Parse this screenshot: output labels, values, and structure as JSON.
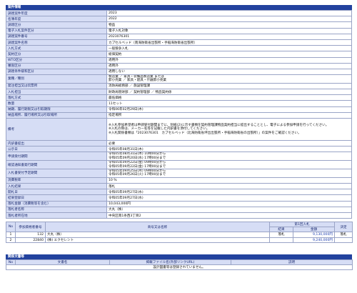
{
  "info_section": {
    "title": "案件情報",
    "rows": [
      {
        "k": "調達案件年度",
        "v": [
          "2023"
        ]
      },
      {
        "k": "名簿年度",
        "v": [
          "2022"
        ]
      },
      {
        "k": "調達区分",
        "v": [
          "物品"
        ]
      },
      {
        "k": "電子入札案件区分",
        "v": [
          "電子入札対象"
        ]
      },
      {
        "k": "調達案件番号",
        "v": [
          "2023076301"
        ]
      },
      {
        "k": "調達案件名称",
        "v": [
          "カプセルベッド（南海防衛省出張所・手稲海防衛省出張所）"
        ]
      },
      {
        "k": "入札方式",
        "v": [
          "一般競争入札"
        ]
      },
      {
        "k": "契約区分",
        "v": [
          "総価契約"
        ]
      },
      {
        "k": "WTO区分",
        "v": [
          "適用外"
        ]
      },
      {
        "k": "審査区分",
        "v": [
          "適用外"
        ]
      },
      {
        "k": "調達条件緩和区分",
        "v": [
          "適用しない"
        ]
      },
      {
        "k": "業種／種別",
        "v": [
          "製造業 ／ 家具・装備品製造業 または",
          "卸小売業 ／ 家具・建具・什器卸小売業"
        ],
        "tall": 2
      },
      {
        "k": "発注担当又は伝票所",
        "v": [
          "消防局総務部 ／ 施設管理課"
        ]
      },
      {
        "k": "入札担当",
        "v": [
          "財政局管財部 ／ 契約管理部 ／ 物品契約係"
        ]
      },
      {
        "k": "落札方式",
        "v": [
          "最低価格"
        ]
      },
      {
        "k": "数量",
        "v": [
          "11セット"
        ]
      },
      {
        "k": "納期、履行期限又は引取期限",
        "v": [
          "令和06年02月29日(木)"
        ]
      },
      {
        "k": "納品場所、履行場所又は引取場所",
        "v": [
          "指定場所"
        ]
      },
      {
        "k": "備考",
        "v": [
          "※入札参加希望者は申請受付期間までに、別紙(2)に示す書類を契約管理課物品契約担当に提出することとし、電子による参加申請を行ってください。",
          "※入札の際は、メーカー名等を記載した内訳書を添付してください。",
          "※入札関係書類は「2023076301　カプセルベッド（北海防衛省坪出出張所・手稲海防衛省の出張所）」の案件をご確認ください。"
        ],
        "tall": 3
      },
      {
        "k": "内訳書提出",
        "v": [
          "必要"
        ]
      },
      {
        "k": "公示日",
        "v": [
          "令和05年08月31日(木)"
        ]
      },
      {
        "k": "申請受付期間",
        "v": [
          "令和05年08月31日(木) 10時00分から",
          "令和05年09月20日(水) 17時00分まで"
        ],
        "tall": 2
      },
      {
        "k": "確認通知書発行期間",
        "v": [
          "令和05年09月22日(金) 09時00分から",
          "令和05年09月22日(金) 17時00分まで"
        ],
        "tall": 2
      },
      {
        "k": "入札書受付予定期間",
        "v": [
          "令和05年09月25日(月) 09時00分から",
          "令和05年09月26日(火) 17時00分まで"
        ],
        "tall": 2
      },
      {
        "k": "消費税率",
        "v": [
          "10 %"
        ]
      },
      {
        "k": "入札結果",
        "v": [
          "落札"
        ]
      },
      {
        "k": "開札日",
        "v": [
          "令和05年09月27日(水)"
        ]
      },
      {
        "k": "結果登録日",
        "v": [
          "令和05年09月27日(水)"
        ]
      },
      {
        "k": "落札金額（消費税等を含む）",
        "v": [
          "10,043,000円"
        ]
      },
      {
        "k": "落札者名称",
        "v": [
          "大丸（株）"
        ]
      },
      {
        "k": "落札者所在地",
        "v": [
          "中央区南1条西3丁目2"
        ]
      }
    ]
  },
  "results_table": {
    "headers": {
      "no": "No",
      "reg_no": "参加資格者番号",
      "name": "商号又は名称",
      "round": "第1回入札",
      "result": "結果",
      "amount": "金額",
      "decision": "決定"
    },
    "rows": [
      {
        "no": "1",
        "reg_no": "132",
        "name": "大丸（株）",
        "result": "落札",
        "amount": "9,130,000円",
        "decision": "落札"
      },
      {
        "no": "2",
        "reg_no": "22840",
        "name": "(株) エクセレント",
        "result": "",
        "amount": "9,240,000円",
        "decision": ""
      }
    ]
  },
  "docs_section": {
    "title": "関係文書等",
    "headers": {
      "no": "No",
      "doc": "文書名",
      "file": "掲載ファイル名(外部リンクURL)",
      "note": "説明"
    },
    "empty_message": "設計図書等は登録されていません。"
  },
  "colors": {
    "header_bg": "#22429e",
    "label_bg": "#d6ddf5",
    "amount": "#1d3eb0"
  }
}
